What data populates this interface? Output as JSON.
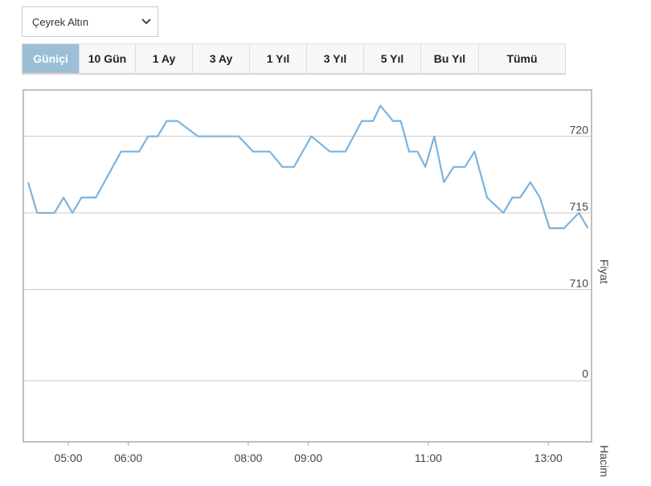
{
  "selector": {
    "value": "Çeyrek Altın"
  },
  "tabs": [
    {
      "label": "Güniçi",
      "active": true
    },
    {
      "label": "10 Gün",
      "active": false
    },
    {
      "label": "1 Ay",
      "active": false
    },
    {
      "label": "3 Ay",
      "active": false
    },
    {
      "label": "1 Yıl",
      "active": false
    },
    {
      "label": "3 Yıl",
      "active": false
    },
    {
      "label": "5 Yıl",
      "active": false
    },
    {
      "label": "Bu Yıl",
      "active": false
    },
    {
      "label": "Tümü",
      "active": false
    }
  ],
  "colors": {
    "line": "#7db3dd",
    "grid": "#c8c8c8",
    "frame": "#aaaaaa",
    "active_tab": "#9bbfd6"
  },
  "chart_data": {
    "type": "line",
    "ylabel": "Fiyat",
    "volume_label": "Hacim",
    "ylim": [
      707.5,
      722.5
    ],
    "y_ticks": [
      710,
      715,
      720
    ],
    "volume_ticks": [
      0
    ],
    "x_ticks": [
      {
        "t": 5.0,
        "label": "05:00"
      },
      {
        "t": 6.0,
        "label": "06:00"
      },
      {
        "t": 8.0,
        "label": "08:00"
      },
      {
        "t": 9.0,
        "label": "09:00"
      },
      {
        "t": 11.0,
        "label": "11:00"
      },
      {
        "t": 13.0,
        "label": "13:00"
      }
    ],
    "x_range": [
      4.25,
      13.72
    ],
    "series": [
      {
        "x": [
          4.33,
          4.48,
          4.77,
          4.92,
          5.07,
          5.22,
          5.46,
          5.88,
          6.18,
          6.33,
          6.49,
          6.64,
          6.82,
          7.16,
          7.5,
          7.84,
          8.08,
          8.36,
          8.57,
          8.76,
          9.05,
          9.36,
          9.62,
          9.89,
          10.08,
          10.2,
          10.41,
          10.54,
          10.68,
          10.82,
          10.95,
          11.1,
          11.26,
          11.42,
          11.61,
          11.77,
          11.98,
          12.25,
          12.4,
          12.53,
          12.7,
          12.86,
          13.02,
          13.26,
          13.51,
          13.66
        ],
        "values": [
          717,
          715,
          715,
          716,
          715,
          716,
          716,
          719,
          719,
          720,
          720,
          721,
          721,
          720,
          720,
          720,
          719,
          719,
          718,
          718,
          720,
          719,
          719,
          721,
          721,
          722,
          721,
          721,
          719,
          719,
          718,
          720,
          717,
          718,
          718,
          719,
          716,
          715,
          716,
          716,
          717,
          716,
          714,
          714,
          715,
          714
        ]
      }
    ]
  }
}
